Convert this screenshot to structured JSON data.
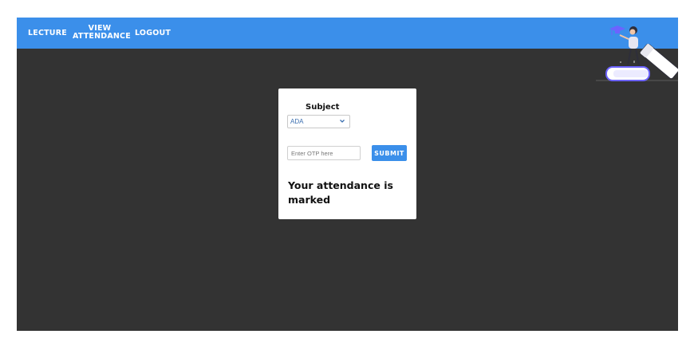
{
  "nav": {
    "lecture_label": "LECTURE",
    "view_attendance_line1": "VIEW",
    "view_attendance_line2": "ATTENDANCE",
    "logout_label": "LOGOUT"
  },
  "form": {
    "subject_label": "Subject",
    "subject_selected": "ADA",
    "otp_placeholder": "Enter OTP here",
    "submit_label": "SUBMIT"
  },
  "status": {
    "message": "Your attendance is marked"
  },
  "illustration": {
    "icon": "person-on-book-illustration"
  },
  "colors": {
    "accent": "#3b8fea",
    "background": "#333333",
    "card": "#ffffff"
  }
}
